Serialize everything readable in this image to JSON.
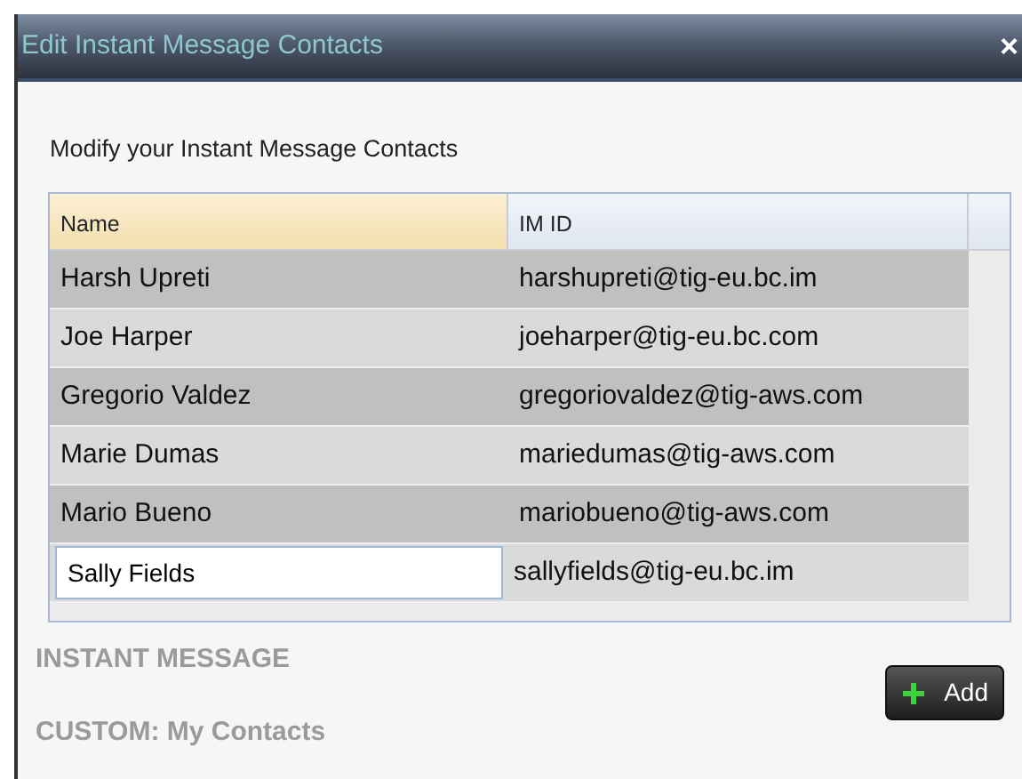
{
  "dialog": {
    "title": "Edit Instant Message Contacts",
    "close": "×",
    "instruction": "Modify your Instant Message Contacts"
  },
  "table": {
    "columns": [
      "Name",
      "IM ID"
    ],
    "rows": [
      {
        "name": "Harsh Upreti",
        "im_id": "harshupreti@tig-eu.bc.im",
        "editing": false
      },
      {
        "name": "Joe Harper",
        "im_id": "joeharper@tig-eu.bc.com",
        "editing": false
      },
      {
        "name": "Gregorio Valdez",
        "im_id": "gregoriovaldez@tig-aws.com",
        "editing": false
      },
      {
        "name": "Marie Dumas",
        "im_id": "mariedumas@tig-aws.com",
        "editing": false
      },
      {
        "name": "Mario Bueno",
        "im_id": "mariobueno@tig-aws.com",
        "editing": false
      },
      {
        "name": "Sally Fields",
        "im_id": "sallyfields@tig-eu.bc.im",
        "editing": true
      }
    ]
  },
  "background_sections": [
    "INSTANT MESSAGE",
    "CUSTOM: My Contacts"
  ],
  "add_button": {
    "label": "Add"
  }
}
